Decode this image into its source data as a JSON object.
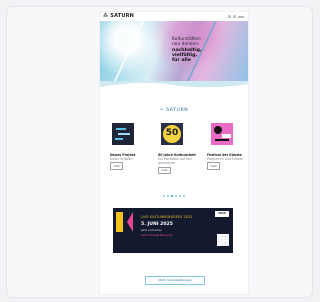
{
  "site": {
    "logo_text": "SATURN"
  },
  "hero": {
    "line1": "Kulturstätten",
    "line2": "neu denken:",
    "line3": "nachhaltig,",
    "line4": "vielfältig,",
    "line5": "für alle"
  },
  "section": {
    "logo": "SATURN"
  },
  "articles": [
    {
      "title": "Neues Projekt",
      "subtitle": "Kultur erleben",
      "more": "mehr"
    },
    {
      "title": "50 Jahre Kulturarbeit",
      "subtitle": "Ein Rückblick auf fünf Jahrzehnte",
      "more": "mehr"
    },
    {
      "title": "Festival der Künste",
      "subtitle": "Programm und Tickets",
      "more": "mehr"
    }
  ],
  "carousel": {
    "count": 6,
    "active": 2
  },
  "banner": {
    "badge": "2025",
    "header": "LIVE KULTURKONGRESS 2025",
    "date": "5. JUNI 2025",
    "sub": "Jetzt anmelden",
    "sub2": "Kultur bewegt Menschen"
  },
  "cta": {
    "label": "Mehr Veranstaltungen"
  },
  "colors": {
    "accent": "#2a8fc4",
    "banner_bg": "#131a2e",
    "yellow": "#f2c31d",
    "pink": "#e64595"
  }
}
